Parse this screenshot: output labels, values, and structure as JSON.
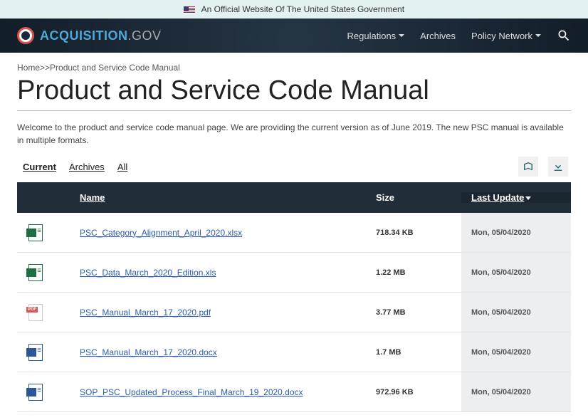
{
  "banner": {
    "text": "An Official Website Of The United States Government"
  },
  "logo": {
    "acq": "ACQUISITION",
    "gov": ".GOV"
  },
  "nav": {
    "regulations": "Regulations",
    "archives": "Archives",
    "policy_network": "Policy Network"
  },
  "breadcrumb": {
    "home": "Home",
    "sep": ">>",
    "current": "Product and Service Code Manual"
  },
  "title": "Product and Service Code Manual",
  "intro": "Welcome to the product and service code manual page. We are providing the current version as of June 2019. The new PSC manual is available in multiple formats.",
  "tabs": {
    "current": "Current",
    "archives": "Archives",
    "all": "All"
  },
  "table": {
    "headers": {
      "name": "Name",
      "size": "Size",
      "last_update": "Last Update"
    },
    "rows": [
      {
        "icon": "excel",
        "name": "PSC_Category_Alignment_April_2020.xlsx",
        "size": "718.34 KB",
        "updated": "Mon, 05/04/2020"
      },
      {
        "icon": "excel",
        "name": "PSC_Data_March_2020_Edition.xls",
        "size": "1.22 MB",
        "updated": "Mon, 05/04/2020"
      },
      {
        "icon": "pdf",
        "name": "PSC_Manual_March_17_2020.pdf",
        "size": "3.77 MB",
        "updated": "Mon, 05/04/2020"
      },
      {
        "icon": "word",
        "name": "PSC_Manual_March_17_2020.docx",
        "size": "1.7 MB",
        "updated": "Mon, 05/04/2020"
      },
      {
        "icon": "word",
        "name": "SOP_PSC_Updated_Process_Final_March_19_2020.docx",
        "size": "972.96 KB",
        "updated": "Mon, 05/04/2020"
      }
    ]
  }
}
